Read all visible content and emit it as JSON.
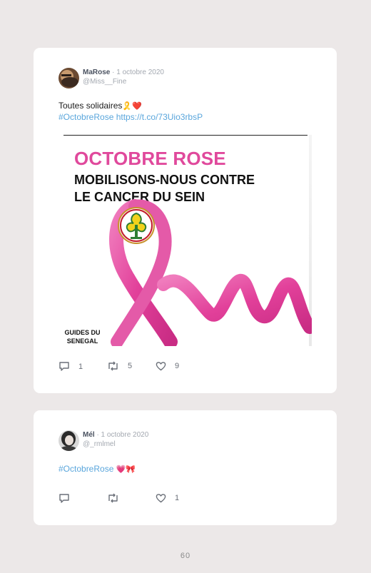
{
  "tweets": [
    {
      "user": "MaRose",
      "date": "· 1 octobre 2020",
      "handle": "@Miss__Fine",
      "line1": "Toutes solidaires",
      "line1_emoji": "🎗️❤️",
      "hashtag": "#OctobreRose",
      "url": "https://t.co/73Uio3rbsP",
      "image": {
        "title": "OCTOBRE ROSE",
        "subtitle_1": "MOBILISONS-NOUS CONTRE",
        "subtitle_2": "LE CANCER DU SEIN",
        "org_1": "GUIDES DU",
        "org_2": "SENEGAL"
      },
      "replies": "1",
      "retweets": "5",
      "likes": "9"
    },
    {
      "user": "Mél",
      "date": "· 1 octobre 2020",
      "handle": "@_rmlmel",
      "hashtag": "#OctobreRose",
      "emoji": "💗🎀",
      "likes": "1"
    }
  ],
  "page_number": "60",
  "colors": {
    "background": "#ece8e8",
    "card": "#ffffff",
    "link": "#5aa6dc",
    "pink": "#e0499c"
  }
}
